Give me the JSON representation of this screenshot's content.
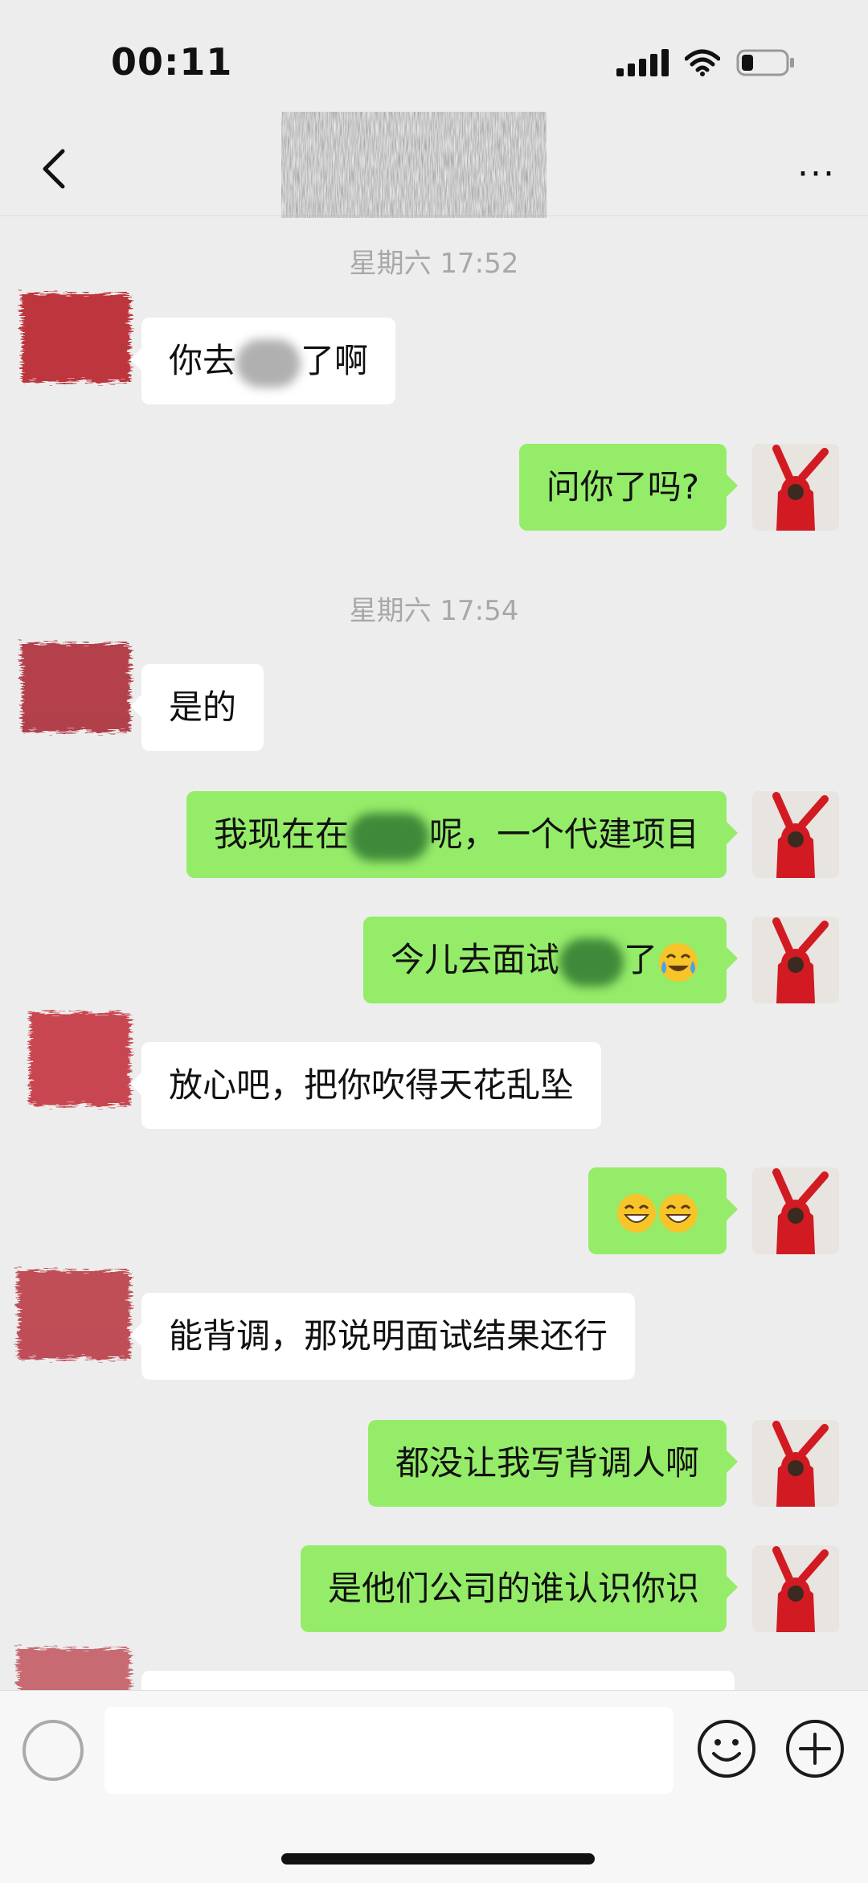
{
  "status_bar": {
    "time": "00:11"
  },
  "nav": {
    "title": "",
    "more_label": "···"
  },
  "messages": [
    {
      "type": "time",
      "text": "星期六 17:52"
    },
    {
      "type": "msg",
      "from": "other",
      "parts": [
        "你去",
        "了啊"
      ]
    },
    {
      "type": "msg",
      "from": "me",
      "text": "问你了吗?"
    },
    {
      "type": "time",
      "text": "星期六 17:54"
    },
    {
      "type": "msg",
      "from": "other",
      "text": "是的"
    },
    {
      "type": "msg",
      "from": "me",
      "parts": [
        "我现在在",
        "呢，一个代建项目"
      ]
    },
    {
      "type": "msg",
      "from": "me",
      "parts": [
        "今儿去面试",
        "了"
      ],
      "emoji": "crying-laughing"
    },
    {
      "type": "msg",
      "from": "other",
      "text": "放心吧，把你吹得天花乱坠"
    },
    {
      "type": "msg",
      "from": "me",
      "emojis": [
        "grinning",
        "grinning"
      ]
    },
    {
      "type": "msg",
      "from": "other",
      "text": "能背调，那说明面试结果还行"
    },
    {
      "type": "msg",
      "from": "me",
      "text": "都没让我写背调人啊"
    },
    {
      "type": "msg",
      "from": "me",
      "text": "是他们公司的谁认识你识"
    }
  ],
  "colors": {
    "me_bubble": "#95ec69",
    "other_bubble": "#ffffff",
    "background": "#ededed",
    "timestamp": "#a8a8a8"
  },
  "icons": [
    "back-chevron-icon",
    "more-icon",
    "voice-icon",
    "emoji-icon",
    "plus-icon"
  ]
}
